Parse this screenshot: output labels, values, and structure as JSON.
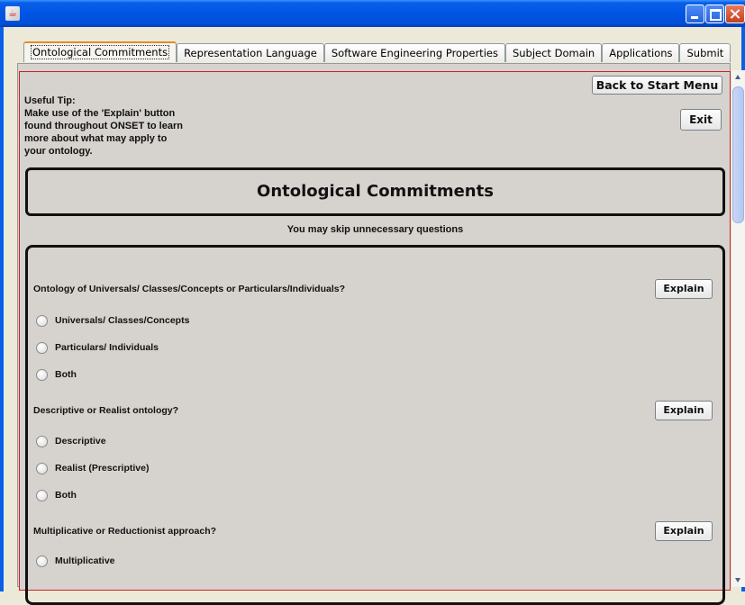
{
  "window": {
    "title": "",
    "icon": "java-cup-icon",
    "controls": [
      "minimize-icon",
      "maximize-icon",
      "close-icon"
    ]
  },
  "tabs": [
    {
      "label": "Ontological Commitments",
      "active": true
    },
    {
      "label": "Representation Language",
      "active": false
    },
    {
      "label": "Software Engineering Properties",
      "active": false
    },
    {
      "label": "Subject Domain",
      "active": false
    },
    {
      "label": "Applications",
      "active": false
    },
    {
      "label": "Submit",
      "active": false
    }
  ],
  "tip": {
    "heading": "Useful Tip:",
    "lines": [
      "Make use of the 'Explain' button",
      "found throughout ONSET to learn",
      "more about what may apply to",
      "your ontology."
    ]
  },
  "buttons": {
    "back": "Back to Start Menu",
    "exit": "Exit",
    "explain": "Explain"
  },
  "section": {
    "title": "Ontological Commitments",
    "subtitle": "You may skip unnecessary questions"
  },
  "questions": [
    {
      "text": "Ontology of Universals/ Classes/Concepts or  Particulars/Individuals?",
      "options": [
        "Universals/ Classes/Concepts",
        "Particulars/ Individuals",
        "Both"
      ]
    },
    {
      "text": "Descriptive or Realist ontology?",
      "options": [
        "Descriptive",
        "Realist (Prescriptive)",
        "Both"
      ]
    },
    {
      "text": "Multiplicative or Reductionist approach?",
      "options": [
        "Multiplicative"
      ]
    }
  ],
  "colors": {
    "titlebar": "#0055E5",
    "panel": "#D6D3CE",
    "border_red": "#CC2222",
    "active_tab_accent": "#E68B2C"
  }
}
